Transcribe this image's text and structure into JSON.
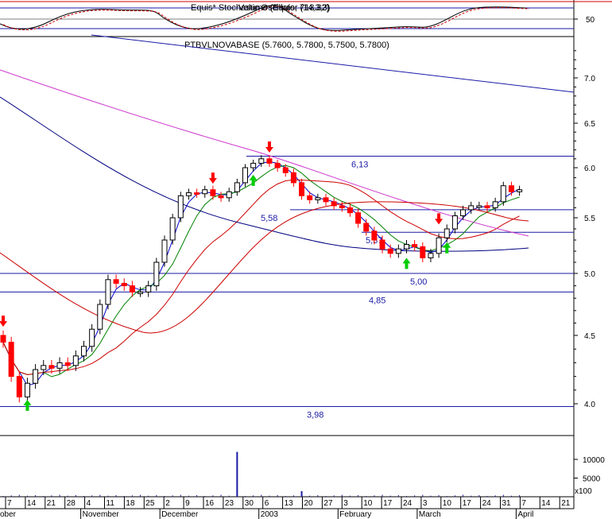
{
  "chart_data": {
    "type": "candlestick",
    "title": "PTBVLNOVABASE (5.7600, 5.7800, 5.7500, 5.7800)",
    "oscillator_title": "Equis* Stochastic Oscillator (14,3,3)",
    "oscillator_overlay_title": "Volume (Equis, 713.32)",
    "y_ticks": [
      "7.0",
      "6.5",
      "6.0",
      "5.5",
      "5.0",
      "4.5",
      "4.0"
    ],
    "osc_ticks": [
      "50"
    ],
    "volume_ticks": [
      "10000",
      "5000"
    ],
    "volume_unit": "x100",
    "x_ticks": [
      "7",
      "14",
      "21",
      "28",
      "4",
      "11",
      "18",
      "25",
      "2",
      "9",
      "16",
      "23",
      "30",
      "6",
      "13",
      "20",
      "27",
      "3",
      "10",
      "17",
      "24",
      "3",
      "10",
      "17",
      "24",
      "31",
      "7",
      "14",
      "21"
    ],
    "month_labels": [
      {
        "label": "ober",
        "tick": 0
      },
      {
        "label": "November",
        "tick": 4
      },
      {
        "label": "December",
        "tick": 8
      },
      {
        "label": "2003",
        "tick": 13
      },
      {
        "label": "February",
        "tick": 17
      },
      {
        "label": "March",
        "tick": 21
      },
      {
        "label": "April",
        "tick": 26
      }
    ],
    "levels": [
      {
        "label": "6,13",
        "value": 6.13
      },
      {
        "label": "5,58",
        "value": 5.58
      },
      {
        "label": "5,37",
        "value": 5.37
      },
      {
        "label": "5,00",
        "value": 5.0
      },
      {
        "label": "4,85",
        "value": 4.85
      },
      {
        "label": "3,98",
        "value": 3.98
      }
    ],
    "prices": [
      4.45,
      4.2,
      4.05,
      4.15,
      4.25,
      4.28,
      4.26,
      4.3,
      4.28,
      4.35,
      4.42,
      4.55,
      4.75,
      4.95,
      4.92,
      4.9,
      4.85,
      4.85,
      4.9,
      5.1,
      5.3,
      5.5,
      5.72,
      5.75,
      5.74,
      5.78,
      5.72,
      5.7,
      5.76,
      5.85,
      6.0,
      6.05,
      6.1,
      6.05,
      6.0,
      5.95,
      5.85,
      5.72,
      5.68,
      5.7,
      5.66,
      5.62,
      5.6,
      5.55,
      5.45,
      5.38,
      5.3,
      5.22,
      5.18,
      5.22,
      5.26,
      5.24,
      5.14,
      5.18,
      5.32,
      5.4,
      5.52,
      5.58,
      5.62,
      5.62,
      5.6,
      5.66,
      5.82,
      5.76,
      5.78
    ],
    "signals": [
      {
        "type": "sell",
        "index": 0
      },
      {
        "type": "buy",
        "index": 3
      },
      {
        "type": "sell",
        "index": 26
      },
      {
        "type": "buy",
        "index": 31
      },
      {
        "type": "sell",
        "index": 33
      },
      {
        "type": "buy",
        "index": 50
      },
      {
        "type": "sell",
        "index": 54
      },
      {
        "type": "buy",
        "index": 55
      }
    ],
    "volume_spikes": [
      {
        "index": 29,
        "value": 12000
      },
      {
        "index": 37,
        "value": 1500
      }
    ],
    "colors": {
      "up": "#ffffff",
      "down": "#ff0000",
      "level": "#1a1aa6",
      "ma_short": "#0000cc",
      "ma_mid": "#008000",
      "ma_long": "#cc0000",
      "ma_longer": "#cc33cc",
      "ma_longest": "#000080",
      "buy": "#00cc00",
      "sell": "#ff0000"
    }
  }
}
